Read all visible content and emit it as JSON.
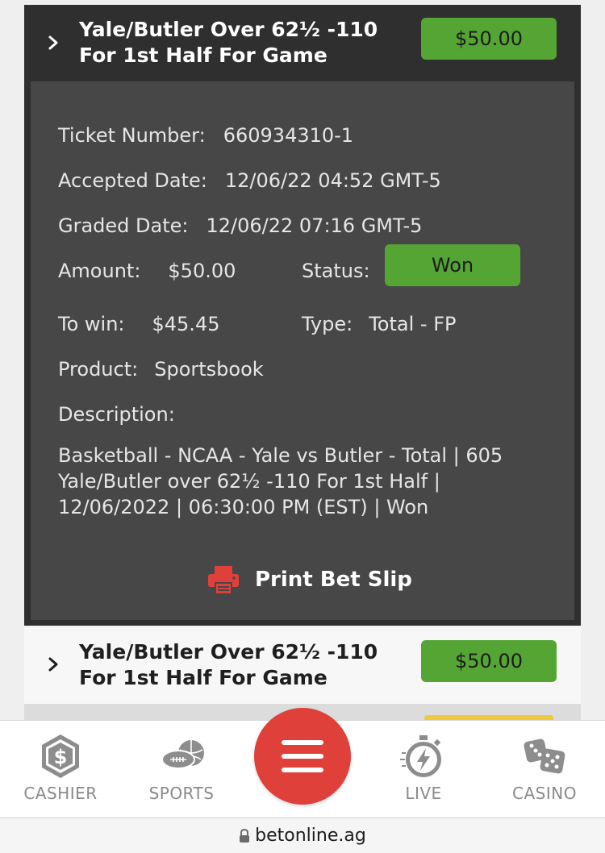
{
  "bets": [
    {
      "title_line1": "Yale/Butler Over 62½ -110",
      "title_line2": "For 1st Half For Game",
      "amount": "$50.00",
      "details": {
        "ticket_label": "Ticket Number:",
        "ticket_value": "660934310-1",
        "accepted_label": "Accepted Date:",
        "accepted_value": "12/06/22 04:52 GMT-5",
        "graded_label": "Graded Date:",
        "graded_value": "12/06/22 07:16 GMT-5",
        "amount_label": "Amount:",
        "amount_value": "$50.00",
        "status_label": "Status:",
        "status_value": "Won",
        "towin_label": "To win:",
        "towin_value": "$45.45",
        "type_label": "Type:",
        "type_value": "Total - FP",
        "product_label": "Product:",
        "product_value": "Sportsbook",
        "description_label": "Description:",
        "description_text": "Basketball - NCAA - Yale vs Butler - Total | 605 Yale/Butler over 62½ -110 For 1st Half | 12/06/2022 | 06:30:00 PM (EST) | Won",
        "print_label": "Print Bet Slip"
      }
    },
    {
      "title_line1": "Yale/Butler Over 62½ -110",
      "title_line2": "For 1st Half For Game",
      "amount": "$50.00"
    }
  ],
  "nav": {
    "cashier": "CASHIER",
    "sports": "SPORTS",
    "live": "LIVE",
    "casino": "CASINO"
  },
  "url": "betonline.ag",
  "colors": {
    "accent_green": "#55a534",
    "menu_red": "#e0403a",
    "print_red": "#e0403a"
  }
}
